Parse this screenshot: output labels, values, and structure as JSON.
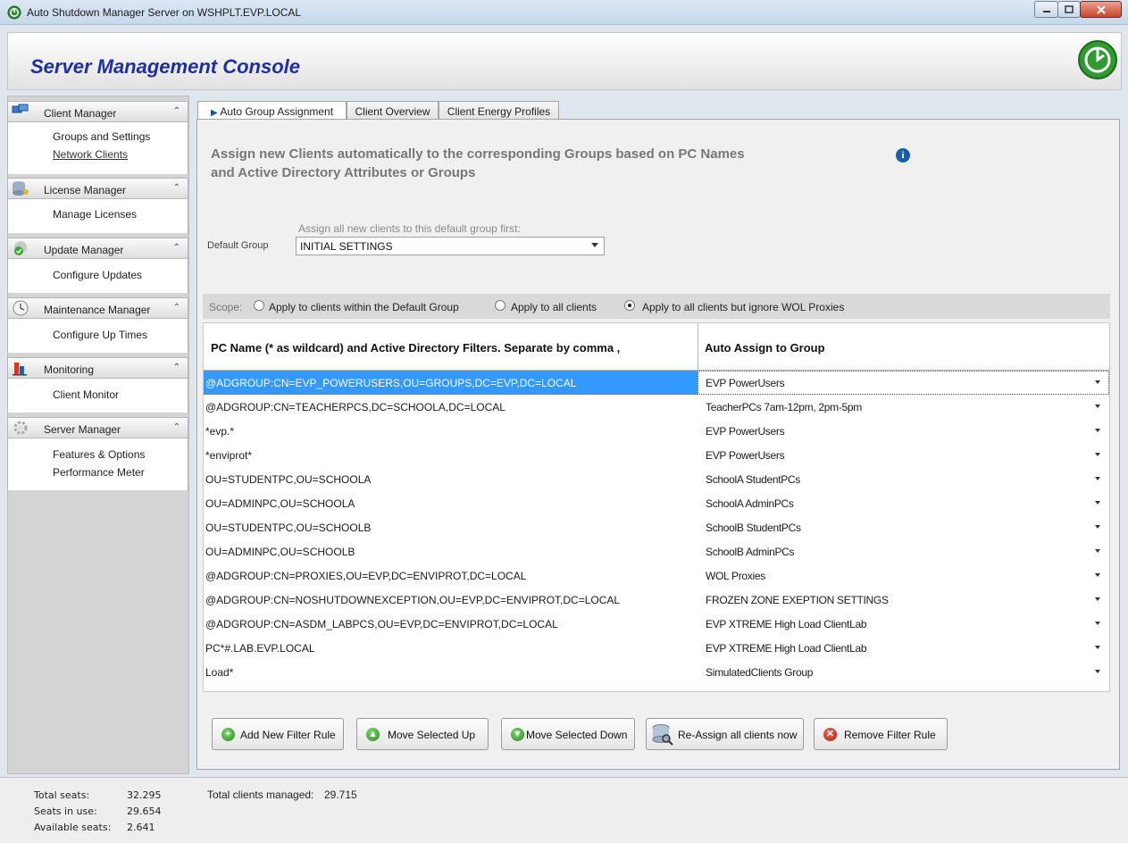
{
  "window": {
    "title": "Auto Shutdown Manager Server on WSHPLT.EVP.LOCAL"
  },
  "header": {
    "title": "Server Management Console"
  },
  "sidebar": {
    "sections": [
      {
        "title": "Client Manager",
        "icon": "monitors-icon",
        "items": [
          "Groups and Settings",
          "Network Clients"
        ]
      },
      {
        "title": "License Manager",
        "icon": "database-key-icon",
        "items": [
          "Manage Licenses"
        ]
      },
      {
        "title": "Update  Manager",
        "icon": "update-check-icon",
        "items": [
          "Configure Updates"
        ]
      },
      {
        "title": "Maintenance Manager",
        "icon": "clock-icon",
        "items": [
          "Configure Up Times"
        ]
      },
      {
        "title": "Monitoring",
        "icon": "bar-chart-icon",
        "items": [
          "Client Monitor"
        ]
      },
      {
        "title": "Server Manager",
        "icon": "gear-icon",
        "items": [
          "Features & Options",
          "Performance Meter"
        ]
      }
    ]
  },
  "tabs": [
    "Auto Group Assignment",
    "Client Overview",
    "Client Energy Profiles"
  ],
  "main": {
    "heading_line1": "Assign new Clients automatically to the corresponding Groups based on PC Names",
    "heading_line2": "and Active Directory Attributes or Groups",
    "default_group_hint": "Assign all new clients to this default group first:",
    "default_group_label": "Default Group",
    "default_group_value": "INITIAL SETTINGS",
    "scope_label": "Scope:",
    "scope_options": [
      "Apply to clients within the Default Group",
      "Apply to all clients",
      "Apply to all clients but  ignore WOL Proxies"
    ],
    "scope_selected": 2,
    "col1_header": "PC Name (* as wildcard) and Active Directory Filters. Separate by comma ,",
    "col2_header": "Auto Assign to Group",
    "rows": [
      {
        "filter": "@ADGROUP:CN=EVP_POWERUSERS,OU=GROUPS,DC=EVP,DC=LOCAL",
        "group": "EVP PowerUsers"
      },
      {
        "filter": "@ADGROUP:CN=TEACHERPCS,DC=SCHOOLA,DC=LOCAL",
        "group": "TeacherPCs 7am-12pm, 2pm-5pm"
      },
      {
        "filter": "*evp.*",
        "group": "EVP PowerUsers"
      },
      {
        "filter": "*enviprot*",
        "group": "EVP PowerUsers"
      },
      {
        "filter": "OU=STUDENTPC,OU=SCHOOLA",
        "group": "SchoolA StudentPCs"
      },
      {
        "filter": "OU=ADMINPC,OU=SCHOOLA",
        "group": "SchoolA AdminPCs"
      },
      {
        "filter": "OU=STUDENTPC,OU=SCHOOLB",
        "group": "SchoolB StudentPCs"
      },
      {
        "filter": "OU=ADMINPC,OU=SCHOOLB",
        "group": "SchoolB AdminPCs"
      },
      {
        "filter": "@ADGROUP:CN=PROXIES,OU=EVP,DC=ENVIPROT,DC=LOCAL",
        "group": "WOL Proxies"
      },
      {
        "filter": "@ADGROUP:CN=NOSHUTDOWNEXCEPTION,OU=EVP,DC=ENVIPROT,DC=LOCAL",
        "group": "FROZEN ZONE EXEPTION SETTINGS"
      },
      {
        "filter": "@ADGROUP:CN=ASDM_LABPCS,OU=EVP,DC=ENVIPROT,DC=LOCAL",
        "group": "EVP XTREME High Load ClientLab"
      },
      {
        "filter": "PC*#.LAB.EVP.LOCAL",
        "group": "EVP XTREME High Load ClientLab"
      },
      {
        "filter": "Load*",
        "group": "SimulatedClients Group"
      }
    ],
    "buttons": {
      "add": "Add New Filter Rule",
      "up": "Move Selected Up",
      "down": "Move Selected Down",
      "reassign": "Re-Assign all clients now",
      "remove": "Remove Filter Rule"
    }
  },
  "footer": {
    "total_seats_label": "Total seats:",
    "total_seats_value": "32.295",
    "seats_in_use_label": "Seats in use:",
    "seats_in_use_value": "29.654",
    "available_label": "Available seats:",
    "available_value": "2.641",
    "total_clients_label": "Total clients managed:",
    "total_clients_value": "29.715"
  }
}
